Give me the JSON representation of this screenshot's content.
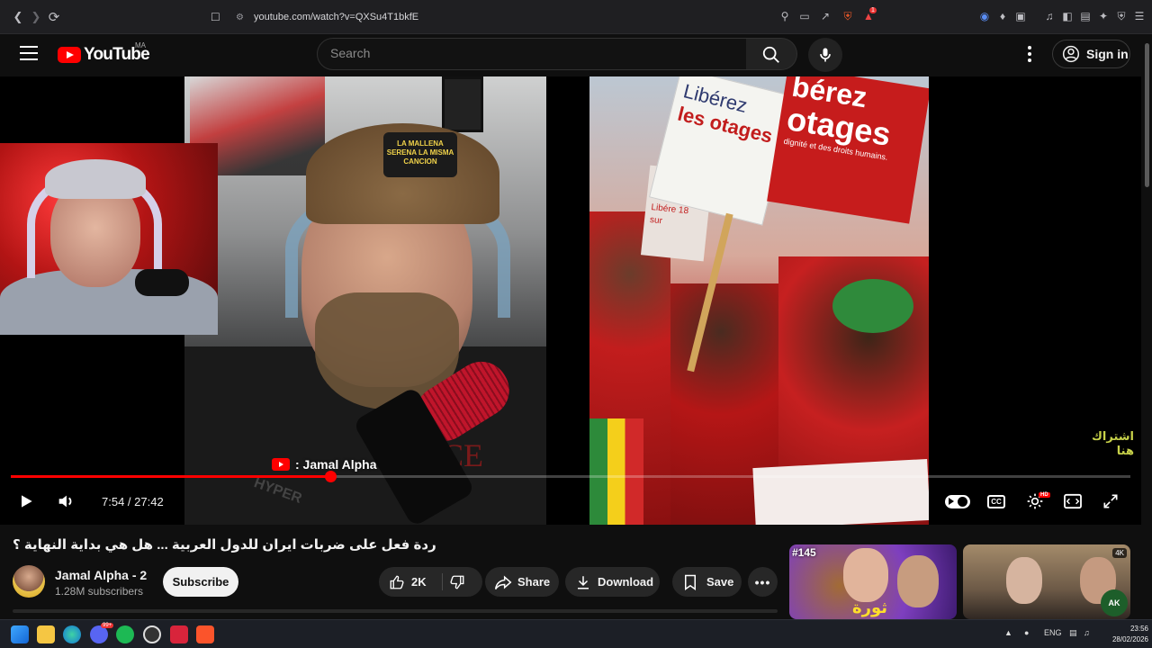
{
  "browser": {
    "url": "youtube.com/watch?v=QXSu4T1bkfE",
    "badge_count": "1"
  },
  "header": {
    "logo_text": "YouTube",
    "country_code": "MA",
    "search_placeholder": "Search",
    "sign_in_label": "Sign in"
  },
  "player": {
    "name_overlay": ": Jamal Alpha",
    "cap_text": "LA MALLENA SERENA LA MISMA CANCION",
    "sign_left_line1": "Libérez",
    "sign_left_line2": "les otages",
    "sign_right_line1": "bérez",
    "sign_right_line2": "otages",
    "sign_right_line3": "dignité et des droits humains.",
    "sign_back": "Libére 18 sur",
    "shirt_text": "ACE",
    "hyper_text": "HYPER",
    "side_overlay_line1": "اشتراك",
    "side_overlay_line2": "هنا",
    "current_time": "7:54",
    "duration": "27:42",
    "time_display": "7:54 / 27:42",
    "progress_fraction": 0.2854,
    "hd_badge": "HD"
  },
  "video": {
    "title": "ردة فعل على ضربات ايران للدول العربية ... هل هي بداية النهاية ؟",
    "channel_name": "Jamal Alpha - 2",
    "subscribers": "1.28M subscribers",
    "subscribe_label": "Subscribe",
    "like_count": "2K",
    "share_label": "Share",
    "download_label": "Download",
    "save_label": "Save"
  },
  "related": [
    {
      "tag": "#145",
      "overlay": "ثورة"
    },
    {
      "badge": "4K",
      "watermark": "AK"
    }
  ],
  "taskbar": {
    "lang": "ENG",
    "time": "23:56",
    "date": "28/02/2026",
    "discord_badge": "99+"
  }
}
